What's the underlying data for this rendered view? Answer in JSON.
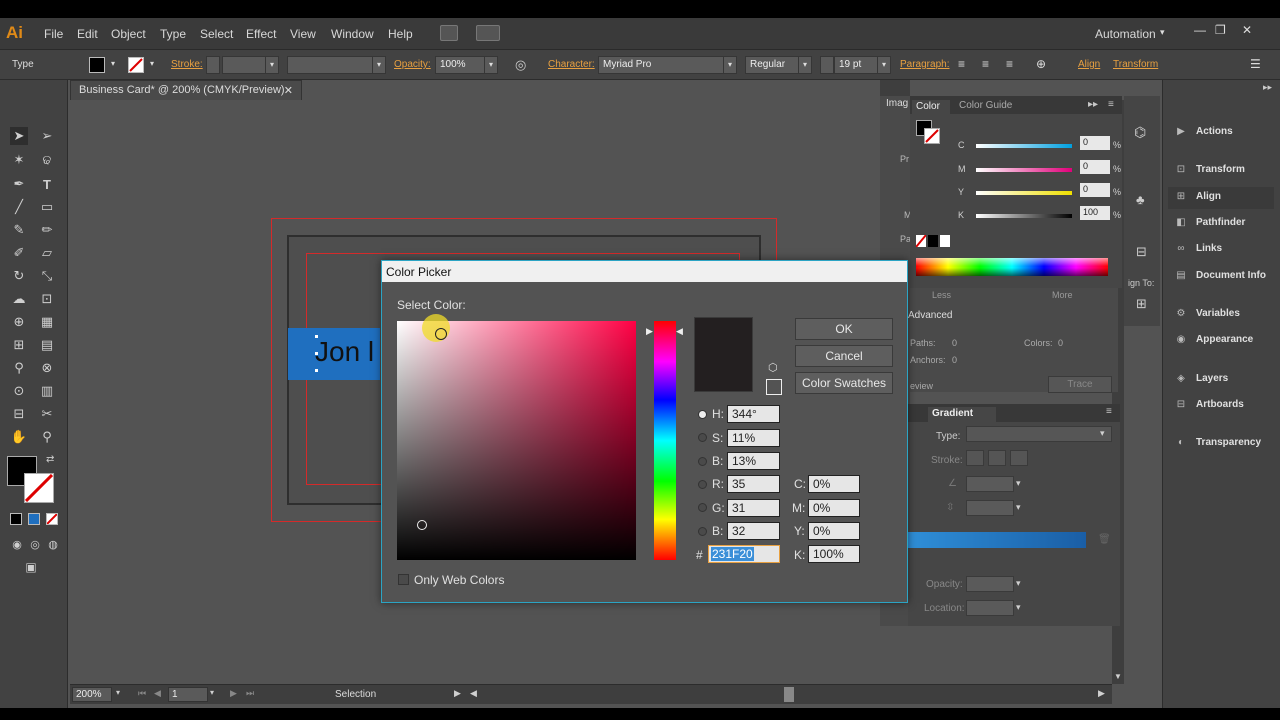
{
  "app": {
    "logo": "Ai",
    "workspace": "Automation"
  },
  "menu": [
    "File",
    "Edit",
    "Object",
    "Type",
    "Select",
    "Effect",
    "View",
    "Window",
    "Help"
  ],
  "control": {
    "mode_label": "Type",
    "stroke_label": "Stroke:",
    "opacity_label": "Opacity:",
    "opacity_value": "100%",
    "character_label": "Character:",
    "font_family": "Myriad Pro",
    "font_style": "Regular",
    "font_size": "19 pt",
    "paragraph_label": "Paragraph:",
    "align_label": "Align",
    "transform_label": "Transform"
  },
  "document": {
    "tab_title": "Business Card* @ 200% (CMYK/Preview)",
    "text_object": "Jon l",
    "zoom": "200%",
    "page": "1",
    "status": "Selection"
  },
  "color_panel": {
    "tab_color": "Color",
    "tab_guide": "Color Guide",
    "channels": [
      {
        "label": "C",
        "value": "0"
      },
      {
        "label": "M",
        "value": "0"
      },
      {
        "label": "Y",
        "value": "0"
      },
      {
        "label": "K",
        "value": "100"
      }
    ],
    "percent": "%"
  },
  "image_trace": {
    "tab": "Imag",
    "less": "Less",
    "more": "More",
    "advanced": "Advanced",
    "paths": "Paths:",
    "paths_val": "0",
    "colors": "Colors:",
    "colors_val": "0",
    "anchors": "Anchors:",
    "anchors_val": "0",
    "preview": "eview",
    "trace": "Trace",
    "align_to": "ign To:",
    "letters": [
      "Pr",
      "M",
      "Pa"
    ]
  },
  "gradient_panel": {
    "tab": "Gradient",
    "type_label": "Type:",
    "stroke_label": "Stroke:",
    "opacity_label": "Opacity:",
    "location_label": "Location:"
  },
  "dock": [
    "Actions",
    "Transform",
    "Align",
    "Pathfinder",
    "Links",
    "Document Info",
    "Variables",
    "Appearance",
    "Layers",
    "Artboards",
    "Transparency"
  ],
  "picker": {
    "title": "Color Picker",
    "select_label": "Select Color:",
    "ok": "OK",
    "cancel": "Cancel",
    "swatches": "Color Swatches",
    "hue_deg": 344,
    "fields": {
      "H": "344°",
      "S": "11%",
      "B": "13%",
      "R": "35",
      "G": "31",
      "Bl": "32",
      "C": "0%",
      "M": "0%",
      "Y": "0%",
      "K": "100%",
      "hex": "231F20"
    },
    "labels": {
      "H": "H:",
      "S": "S:",
      "B": "B:",
      "R": "R:",
      "G": "G:",
      "Bl": "B:",
      "C": "C:",
      "M": "M:",
      "Y": "Y:",
      "K": "K:",
      "hash": "#"
    },
    "web_only": "Only Web Colors",
    "current_color": "#231f20"
  },
  "colors": {
    "accent": "#2ba4c4",
    "selection": "#1f6fbf",
    "orange": "#e8a040"
  }
}
